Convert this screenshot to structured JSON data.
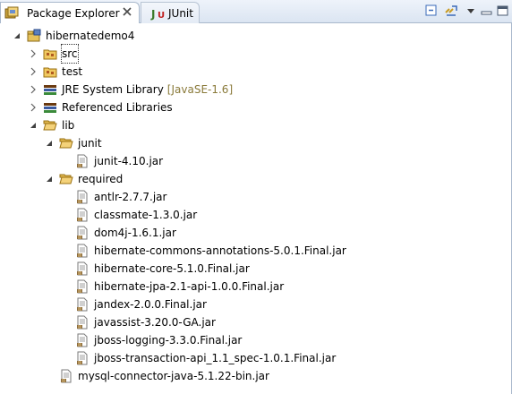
{
  "tabs": {
    "package_explorer": "Package Explorer",
    "junit": "JUnit"
  },
  "tree": {
    "project": "hibernatedemo4",
    "src": "src",
    "test": "test",
    "jre": {
      "label": "JRE System Library",
      "decoration": "[JavaSE-1.6]"
    },
    "referenced": "Referenced Libraries",
    "lib": "lib",
    "junit_folder": "junit",
    "junit_jar": "junit-4.10.jar",
    "required_folder": "required",
    "required_jars": [
      "antlr-2.7.7.jar",
      "classmate-1.3.0.jar",
      "dom4j-1.6.1.jar",
      "hibernate-commons-annotations-5.0.1.Final.jar",
      "hibernate-core-5.1.0.Final.jar",
      "hibernate-jpa-2.1-api-1.0.0.Final.jar",
      "jandex-2.0.0.Final.jar",
      "javassist-3.20.0-GA.jar",
      "jboss-logging-3.3.0.Final.jar",
      "jboss-transaction-api_1.1_spec-1.0.1.Final.jar"
    ],
    "mysql_jar": "mysql-connector-java-5.1.22-bin.jar"
  },
  "icons": {
    "collapse": "collapse-all-icon",
    "link": "link-with-editor-icon",
    "menu": "view-menu-icon",
    "minimize": "minimize-icon",
    "maximize": "maximize-icon"
  }
}
